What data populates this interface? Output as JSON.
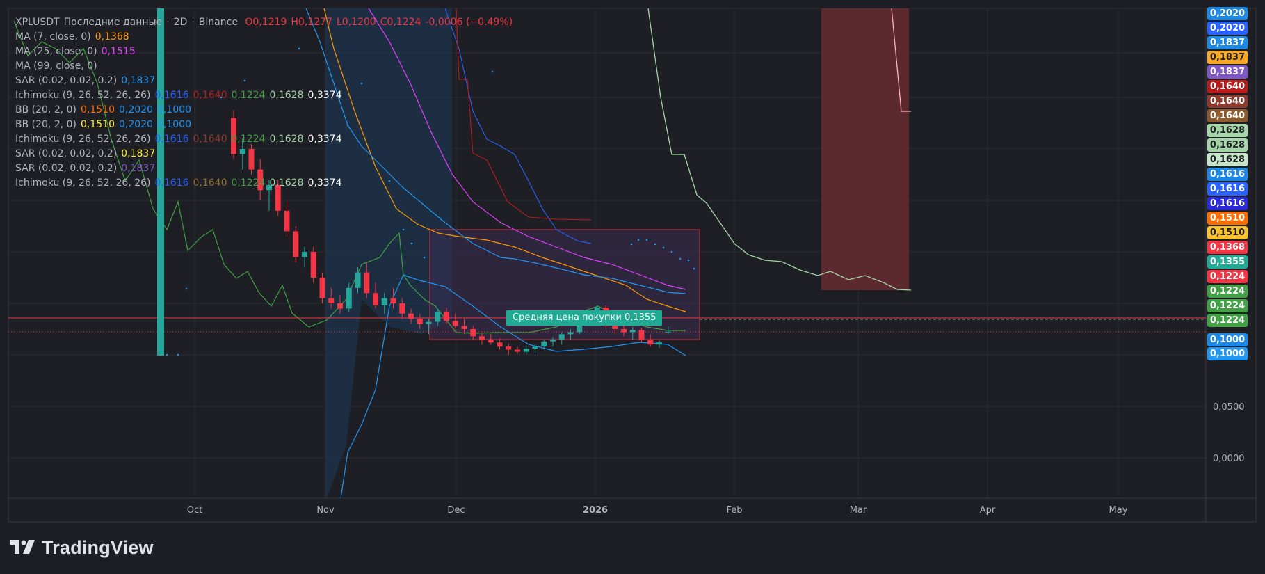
{
  "header": {
    "symbol": "XPLUSDT",
    "data_label": "Последние данные",
    "interval": "2D",
    "exchange": "Binance",
    "open": "O0,1219",
    "high": "H0,1277",
    "low": "L0,1200",
    "close": "C0,1224",
    "change": "-0,0006 (−0.49%)"
  },
  "indicators": [
    {
      "name": "MA (7, close, 0)",
      "values": [
        {
          "v": "0,1368",
          "color": "#ff9800"
        }
      ]
    },
    {
      "name": "MA (25, close, 0)",
      "values": [
        {
          "v": "0,1515",
          "color": "#e040fb"
        }
      ]
    },
    {
      "name": "MA (99, close, 0)",
      "values": []
    },
    {
      "name": "SAR (0.02, 0.02, 0.2)",
      "values": [
        {
          "v": "0,1837",
          "color": "#2196f3"
        }
      ]
    },
    {
      "name": "Ichimoku (9, 26, 52, 26, 26)",
      "values": [
        {
          "v": "0,1616",
          "color": "#2962ff"
        },
        {
          "v": "0,1640",
          "color": "#b71c1c"
        },
        {
          "v": "0,1224",
          "color": "#43a047"
        },
        {
          "v": "0,1628",
          "color": "#a5d6a7"
        },
        {
          "v": "0,3374",
          "color": "#ffffff"
        }
      ]
    },
    {
      "name": "BB (20, 2, 0)",
      "values": [
        {
          "v": "0,1510",
          "color": "#ff6d00"
        },
        {
          "v": "0,2020",
          "color": "#2196f3"
        },
        {
          "v": "0,1000",
          "color": "#2196f3"
        }
      ]
    },
    {
      "name": "BB (20, 2, 0)",
      "values": [
        {
          "v": "0,1510",
          "color": "#ffeb3b"
        },
        {
          "v": "0,2020",
          "color": "#2196f3"
        },
        {
          "v": "0,1000",
          "color": "#2196f3"
        }
      ]
    },
    {
      "name": "Ichimoku (9, 26, 52, 26, 26)",
      "values": [
        {
          "v": "0,1616",
          "color": "#2962ff"
        },
        {
          "v": "0,1640",
          "color": "#8d3b2e"
        },
        {
          "v": "0,1224",
          "color": "#43a047"
        },
        {
          "v": "0,1628",
          "color": "#a5d6a7"
        },
        {
          "v": "0,3374",
          "color": "#ffffff"
        }
      ]
    },
    {
      "name": "SAR (0.02, 0.02, 0.2)",
      "values": [
        {
          "v": "0,1837",
          "color": "#ffeb3b"
        }
      ]
    },
    {
      "name": "SAR (0.02, 0.02, 0.2)",
      "values": [
        {
          "v": "0,1837",
          "color": "#7e57c2"
        }
      ]
    },
    {
      "name": "Ichimoku (9, 26, 52, 26, 26)",
      "values": [
        {
          "v": "0,1616",
          "color": "#2962ff"
        },
        {
          "v": "0,1640",
          "color": "#8d6e2e"
        },
        {
          "v": "0,1224",
          "color": "#43a047"
        },
        {
          "v": "0,1628",
          "color": "#a5d6a7"
        },
        {
          "v": "0,3374",
          "color": "#ffffff"
        }
      ]
    }
  ],
  "price_tags": [
    {
      "v": "0,2020",
      "bg": "#1e88e5",
      "fg": "#ffffff"
    },
    {
      "v": "0,2020",
      "bg": "#2962ff",
      "fg": "#ffffff"
    },
    {
      "v": "0,1837",
      "bg": "#1e88e5",
      "fg": "#ffffff"
    },
    {
      "v": "0,1837",
      "bg": "#f9a825",
      "fg": "#1e1f24"
    },
    {
      "v": "0,1837",
      "bg": "#7e57c2",
      "fg": "#ffffff"
    },
    {
      "v": "0,1640",
      "bg": "#b71c1c",
      "fg": "#ffffff"
    },
    {
      "v": "0,1640",
      "bg": "#8d3b2e",
      "fg": "#ffffff"
    },
    {
      "v": "0,1640",
      "bg": "#8d5a2e",
      "fg": "#ffffff"
    },
    {
      "v": "0,1628",
      "bg": "#a5d6a7",
      "fg": "#1e1f24"
    },
    {
      "v": "0,1628",
      "bg": "#a5d6a7",
      "fg": "#1e1f24"
    },
    {
      "v": "0,1628",
      "bg": "#c8e6c9",
      "fg": "#1e1f24"
    },
    {
      "v": "0,1616",
      "bg": "#1e88e5",
      "fg": "#ffffff"
    },
    {
      "v": "0,1616",
      "bg": "#2962ff",
      "fg": "#ffffff"
    },
    {
      "v": "0,1616",
      "bg": "#2b2bdb",
      "fg": "#ffffff"
    },
    {
      "v": "0,1510",
      "bg": "#ff6d00",
      "fg": "#ffffff"
    },
    {
      "v": "0,1510",
      "bg": "#fbc02d",
      "fg": "#1e1f24"
    },
    {
      "v": "0,1368",
      "bg": "#f23645",
      "fg": "#ffffff"
    },
    {
      "v": "0,1355",
      "bg": "#22ab94",
      "fg": "#ffffff"
    },
    {
      "v": "0,1224",
      "bg": "#f23645",
      "fg": "#ffffff"
    },
    {
      "v": "0,1224",
      "bg": "#43a047",
      "fg": "#ffffff"
    },
    {
      "v": "0,1224",
      "bg": "#43a047",
      "fg": "#ffffff"
    },
    {
      "v": "0,1224",
      "bg": "#43a047",
      "fg": "#ffffff"
    },
    {
      "v": "0,1000",
      "bg": "#1e88e5",
      "fg": "#ffffff"
    },
    {
      "v": "0,1000",
      "bg": "#2196f3",
      "fg": "#ffffff"
    }
  ],
  "avg_price_label": "Средняя цена покупки 0,1355",
  "logo_text": "TradingView",
  "chart_data": {
    "type": "candlestick",
    "y_ticks": [
      "0,0500",
      "0,0000"
    ],
    "x_ticks": [
      "Oct",
      "Nov",
      "Dec",
      "2026",
      "Feb",
      "Mar",
      "Apr",
      "May"
    ],
    "current_price": 0.1224,
    "avg_buy_price": 0.1355,
    "candles": [
      [
        0.33,
        0.3374,
        0.29,
        0.295
      ],
      [
        0.295,
        0.31,
        0.28,
        0.3
      ],
      [
        0.3,
        0.305,
        0.275,
        0.28
      ],
      [
        0.28,
        0.29,
        0.25,
        0.26
      ],
      [
        0.26,
        0.27,
        0.24,
        0.265
      ],
      [
        0.265,
        0.27,
        0.235,
        0.24
      ],
      [
        0.24,
        0.25,
        0.215,
        0.22
      ],
      [
        0.22,
        0.225,
        0.19,
        0.195
      ],
      [
        0.195,
        0.205,
        0.185,
        0.2
      ],
      [
        0.2,
        0.205,
        0.17,
        0.175
      ],
      [
        0.175,
        0.18,
        0.15,
        0.155
      ],
      [
        0.155,
        0.165,
        0.145,
        0.15
      ],
      [
        0.15,
        0.158,
        0.14,
        0.145
      ],
      [
        0.145,
        0.17,
        0.142,
        0.165
      ],
      [
        0.165,
        0.185,
        0.16,
        0.18
      ],
      [
        0.18,
        0.19,
        0.155,
        0.16
      ],
      [
        0.16,
        0.17,
        0.145,
        0.148
      ],
      [
        0.148,
        0.16,
        0.14,
        0.155
      ],
      [
        0.155,
        0.165,
        0.145,
        0.15
      ],
      [
        0.15,
        0.155,
        0.135,
        0.14
      ],
      [
        0.14,
        0.145,
        0.13,
        0.135
      ],
      [
        0.135,
        0.14,
        0.125,
        0.13
      ],
      [
        0.13,
        0.135,
        0.12,
        0.132
      ],
      [
        0.132,
        0.145,
        0.128,
        0.142
      ],
      [
        0.142,
        0.146,
        0.13,
        0.133
      ],
      [
        0.133,
        0.14,
        0.125,
        0.128
      ],
      [
        0.128,
        0.135,
        0.12,
        0.125
      ],
      [
        0.125,
        0.128,
        0.115,
        0.118
      ],
      [
        0.118,
        0.122,
        0.11,
        0.115
      ],
      [
        0.115,
        0.12,
        0.11,
        0.112
      ],
      [
        0.112,
        0.116,
        0.105,
        0.108
      ],
      [
        0.108,
        0.111,
        0.1,
        0.105
      ],
      [
        0.105,
        0.108,
        0.101,
        0.103
      ],
      [
        0.103,
        0.108,
        0.1,
        0.106
      ],
      [
        0.106,
        0.11,
        0.102,
        0.108
      ],
      [
        0.108,
        0.115,
        0.105,
        0.113
      ],
      [
        0.113,
        0.117,
        0.108,
        0.115
      ],
      [
        0.115,
        0.122,
        0.11,
        0.12
      ],
      [
        0.12,
        0.125,
        0.115,
        0.122
      ],
      [
        0.122,
        0.135,
        0.12,
        0.132
      ],
      [
        0.132,
        0.142,
        0.128,
        0.14
      ],
      [
        0.14,
        0.148,
        0.135,
        0.146
      ],
      [
        0.146,
        0.148,
        0.125,
        0.128
      ],
      [
        0.128,
        0.132,
        0.12,
        0.125
      ],
      [
        0.125,
        0.13,
        0.118,
        0.122
      ],
      [
        0.122,
        0.127,
        0.115,
        0.124
      ],
      [
        0.124,
        0.126,
        0.112,
        0.115
      ],
      [
        0.115,
        0.12,
        0.108,
        0.11
      ],
      [
        0.11,
        0.114,
        0.107,
        0.112
      ],
      [
        0.1219,
        0.1277,
        0.12,
        0.1224
      ]
    ]
  }
}
